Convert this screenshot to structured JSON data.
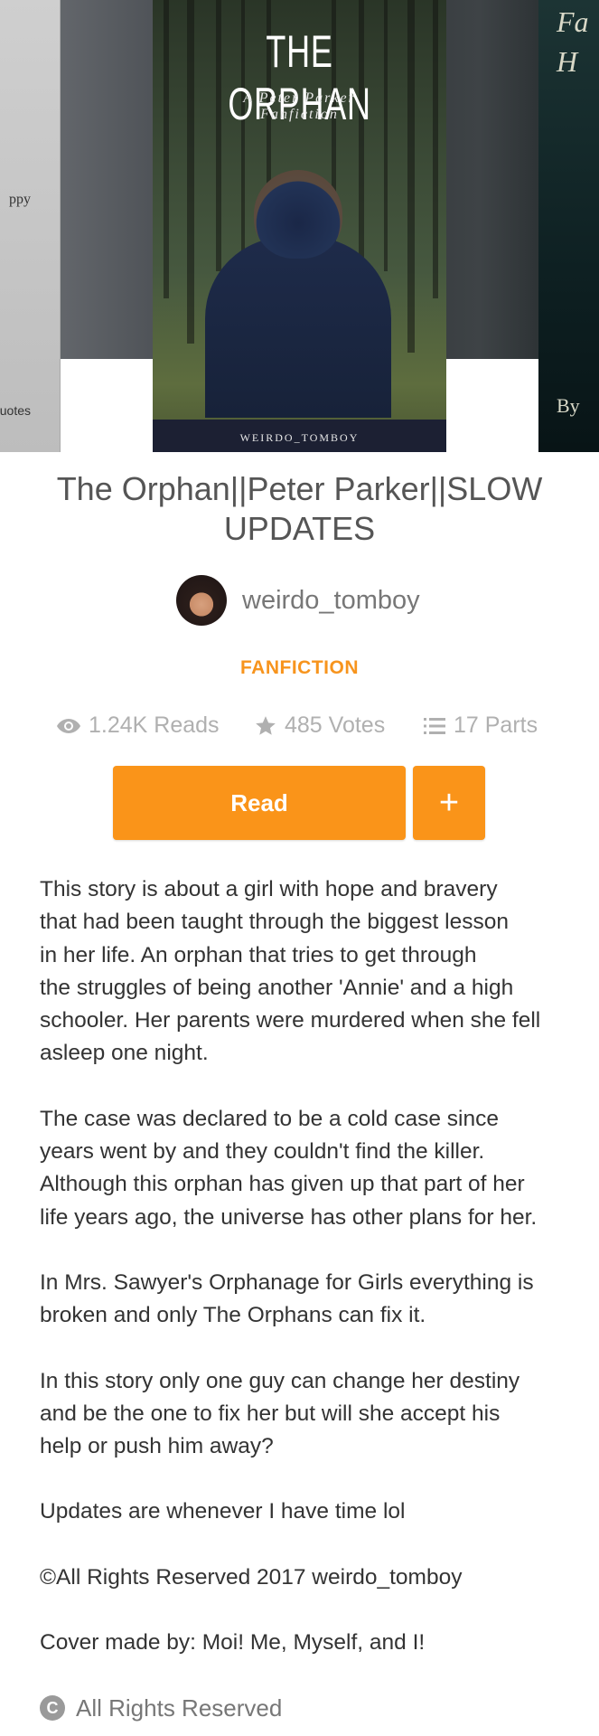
{
  "covers": {
    "prev": {
      "text_top": "ppy",
      "text_bottom": "uotes"
    },
    "current": {
      "title": "THE ORPHAN",
      "subtitle_line1": "A Peter Parker",
      "subtitle_line2": "Fanfiction",
      "author": "WEIRDO_TOMBOY"
    },
    "next": {
      "text_1": "Fa",
      "text_2": "H",
      "text_3": "By"
    }
  },
  "story": {
    "title": "The Orphan||Peter Parker||SLOW UPDATES",
    "author": "weirdo_tomboy",
    "category": "FANFICTION",
    "stats": {
      "reads": "1.24K Reads",
      "votes": "485 Votes",
      "parts": "17 Parts"
    }
  },
  "actions": {
    "read_label": "Read",
    "add_label": "+"
  },
  "description": {
    "paragraphs": [
      "This story is about a girl with hope and bravery\nthat had been taught through the biggest lesson\nin her life. An orphan that tries to get through\nthe struggles of being another 'Annie' and a high\nschooler. Her parents were murdered when she fell\nasleep one night.",
      "The case was declared to be a cold case since\nyears went by and they couldn't find the killer.\nAlthough this orphan has given up that part of her\nlife years ago, the universe has other plans for her.",
      "In Mrs. Sawyer's Orphanage for Girls everything is\nbroken and only The Orphans can fix it.",
      "In this story only one guy can change her destiny\nand be the one to fix her but will she accept his\nhelp or push him away?",
      "Updates are whenever I have time lol",
      "©All Rights Reserved 2017 weirdo_tomboy",
      "Cover made by: Moi! Me, Myself, and I!"
    ]
  },
  "license": {
    "icon_letter": "C",
    "label": "All Rights Reserved"
  },
  "colors": {
    "accent": "#fa9419",
    "category": "#f7941d",
    "muted": "#b0b0b0"
  },
  "icons": {
    "reads": "eye-icon",
    "votes": "star-icon",
    "parts": "list-icon",
    "license": "copyright-icon"
  }
}
